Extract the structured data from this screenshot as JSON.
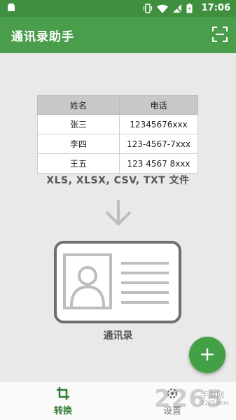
{
  "status_bar": {
    "time": "17:06"
  },
  "app_bar": {
    "title": "通讯录助手"
  },
  "table": {
    "headers": [
      "姓名",
      "电话"
    ],
    "rows": [
      [
        "张三",
        "12345676xxx"
      ],
      [
        "李四",
        "123-4567-7xxx"
      ],
      [
        "王五",
        "123 4567 8xxx"
      ]
    ]
  },
  "formats_text": "XLS, XLSX, CSV, TXT 文件",
  "contacts_label": "通讯录",
  "fab_label": "+",
  "bottom_nav": {
    "convert_label": "转换",
    "settings_label": "设置"
  },
  "watermark": {
    "text": "2265",
    "site": "手游网",
    "url": "2265.com"
  },
  "colors": {
    "primary": "#4a9d4a",
    "status": "#3f8f3f",
    "accent": "#43a047"
  }
}
